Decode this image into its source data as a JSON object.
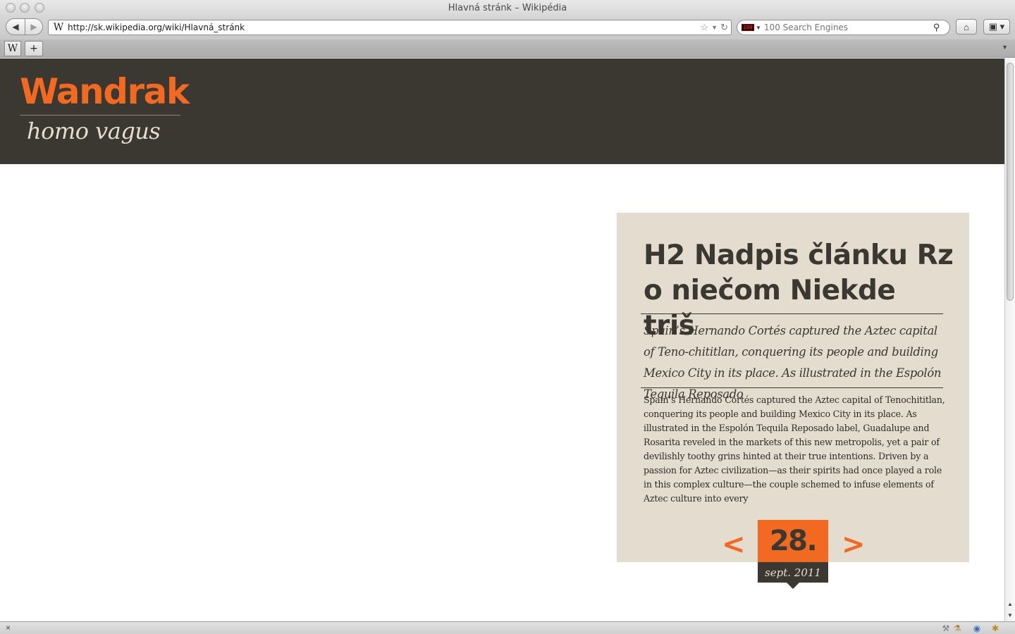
{
  "window": {
    "title": "Hlavná stránk – Wikipédia"
  },
  "toolbar": {
    "url": "http://sk.wikipedia.org/wiki/Hlavná_stránk",
    "favicon": "W",
    "search_placeholder": "100 Search Engines",
    "search_engine_icon": "100"
  },
  "tabs": {
    "active_icon": "W",
    "new_tab": "+"
  },
  "site": {
    "logo": "Wandrak",
    "tagline": "homo vagus"
  },
  "article": {
    "title": "H2 Nadpis článku Rz o niečom Niekde triš",
    "lead": "Spain’s Hernando Cortés captured the Aztec capital of Teno-chititlan, conquering its people and building Mexico City in its place. As illustrated in the Espolón Tequila Reposado",
    "body": "Spain’s Hernando Cortés captured the Aztec capital of Tenochititlan, conquering its people and building Mexico City in its place. As illustrated in the Espolón Tequila Reposado label, Guadalupe and Rosarita reveled in the markets of this new metropolis, yet a pair of devilishly toothy grins hinted at their true intentions. Driven by a passion for Aztec civilization—as their spirits had once played a role in this complex culture—the couple schemed to infuse elements of Aztec culture into every"
  },
  "date_nav": {
    "prev": "<",
    "next": ">",
    "day": "28.",
    "month": "sept. 2011"
  },
  "statusbar": {
    "close": "×"
  },
  "colors": {
    "header_bg": "#3b3731",
    "accent": "#f26a21",
    "article_bg": "#e5dcd0",
    "text_dark": "#3b3731"
  }
}
